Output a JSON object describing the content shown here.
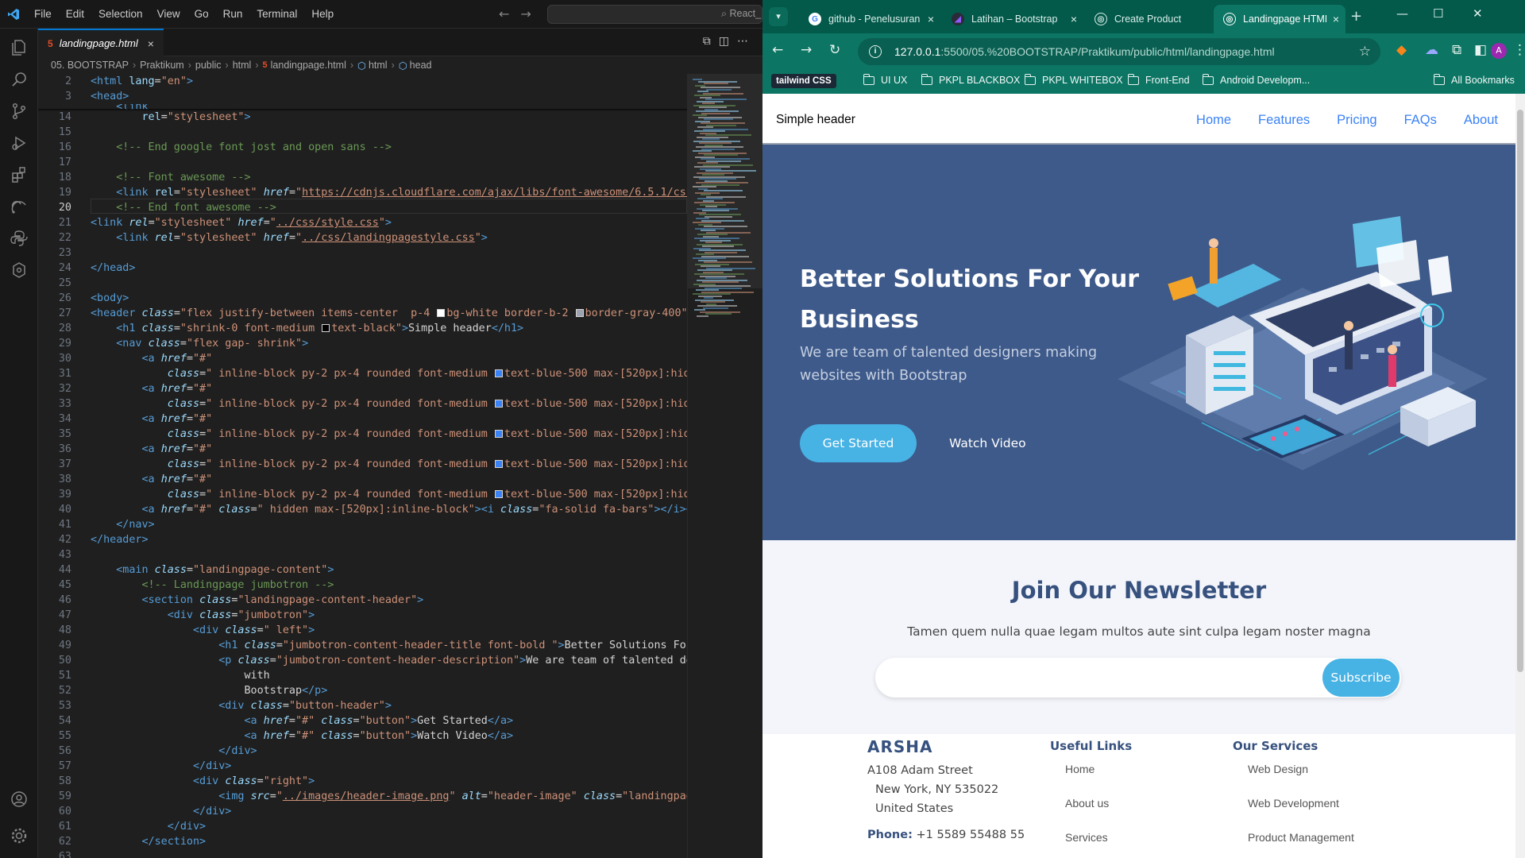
{
  "vscode": {
    "menu": [
      "File",
      "Edit",
      "Selection",
      "View",
      "Go",
      "Run",
      "Terminal",
      "Help"
    ],
    "search_text": "React_",
    "tab_label": "landingpage.html",
    "breadcrumb": [
      "05. BOOTSTRAP",
      "Praktikum",
      "public",
      "html",
      "landingpage.html",
      "html",
      "head"
    ],
    "current_line": 20
  },
  "chrome": {
    "tabs": [
      {
        "title": "github - Penelusuran Google"
      },
      {
        "title": "Latihan – Bootstrap"
      },
      {
        "title": "Create Product"
      },
      {
        "title": "Landingpage HTML"
      }
    ],
    "url_host": "127.0.0.1",
    "url_rest": ":5500/05.%20BOOTSTRAP/Praktikum/public/html/landingpage.html",
    "profile_initial": "A",
    "bookmarks": [
      "tailwind CSS",
      "UI UX",
      "PKPL BLACKBOX",
      "PKPL WHITEBOX",
      "Front-End",
      "Android Developm...",
      "All Bookmarks"
    ]
  },
  "page": {
    "header_title": "Simple header",
    "nav": [
      "Home",
      "Features",
      "Pricing",
      "FAQs",
      "About"
    ],
    "hero": {
      "title": "Better Solutions For Your Business",
      "description": "We are team of talented designers making websites with Bootstrap",
      "btn_primary": "Get Started",
      "btn_secondary": "Watch Video"
    },
    "newsletter": {
      "title": "Join Our Newsletter",
      "description": "Tamen quem nulla quae legam multos aute sint culpa legam noster magna",
      "button": "Subscribe"
    },
    "footer": {
      "brand": "ARSHA",
      "address_1": "A108 Adam Street",
      "address_2": "New York, NY 535022",
      "address_3": "United States",
      "phone_label": "Phone:",
      "phone": "+1 5589 55488 55",
      "links_title": "Useful Links",
      "links": [
        "Home",
        "About us",
        "Services"
      ],
      "services_title": "Our Services",
      "services": [
        "Web Design",
        "Web Development",
        "Product Management"
      ]
    }
  }
}
